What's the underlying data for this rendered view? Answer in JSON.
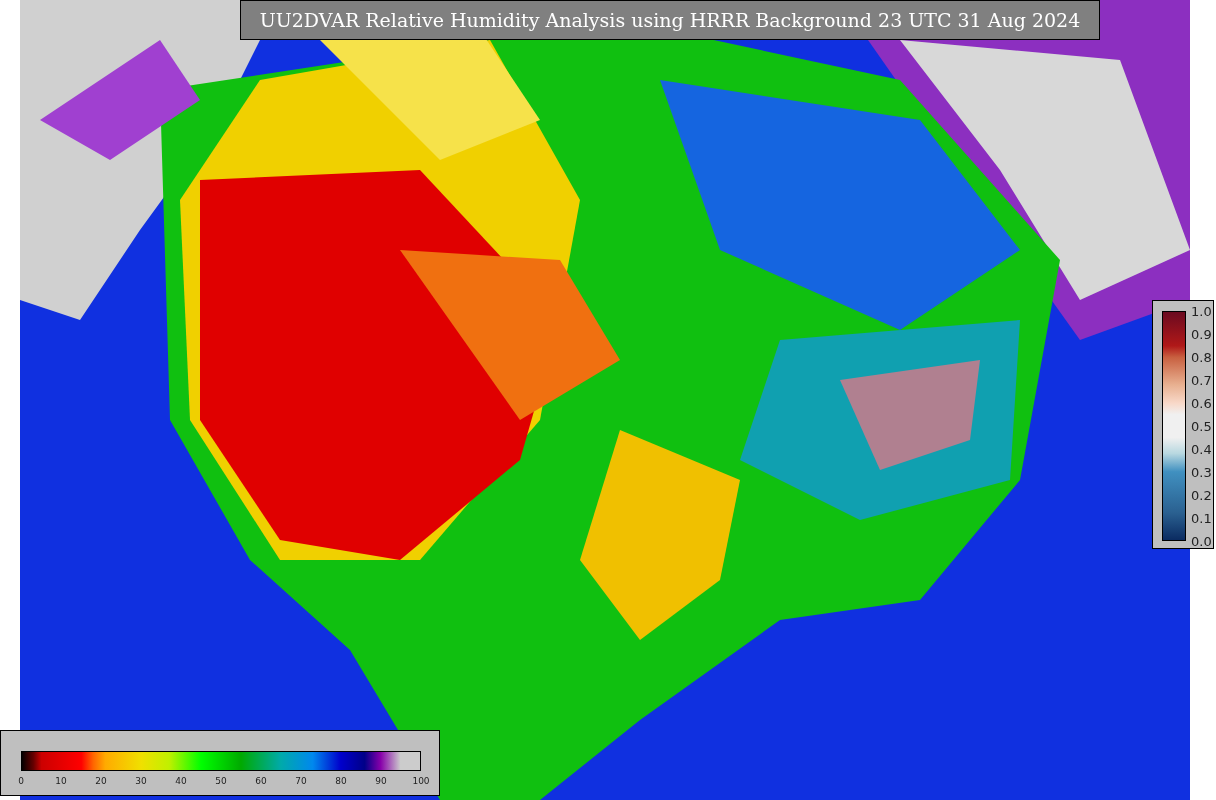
{
  "title": "UU2DVAR Relative Humidity Analysis using HRRR Background 23 UTC 31 Aug 2024",
  "humidity_colorbar": {
    "ticks": [
      "0",
      "10",
      "20",
      "30",
      "40",
      "50",
      "60",
      "70",
      "80",
      "90",
      "100"
    ]
  },
  "ratio_colorbar": {
    "ticks": [
      "1.0",
      "0.9",
      "0.8",
      "0.7",
      "0.6",
      "0.5",
      "0.4",
      "0.3",
      "0.2",
      "0.1",
      "0.0"
    ]
  }
}
